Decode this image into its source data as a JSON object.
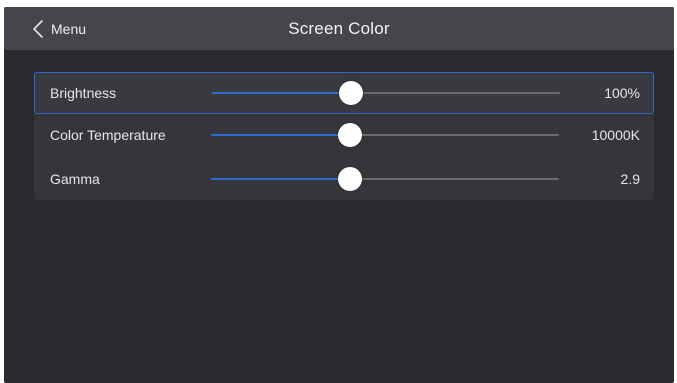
{
  "header": {
    "back_label": "Menu",
    "back_icon": "chevron-left-icon",
    "title": "Screen Color"
  },
  "settings": [
    {
      "label": "Brightness",
      "value": "100%",
      "slider_level": 0.4,
      "selected": true
    },
    {
      "label": "Color Temperature",
      "value": "10000K",
      "slider_level": 0.4,
      "selected": false
    },
    {
      "label": "Gamma",
      "value": "2.9",
      "slider_level": 0.4,
      "selected": false
    }
  ],
  "colors": {
    "accent": "#2d6bd0",
    "selected_border": "#2f67c9",
    "header_bg": "#45464b",
    "panel_bg": "#35363a",
    "screen_bg": "#2a2b2f"
  }
}
